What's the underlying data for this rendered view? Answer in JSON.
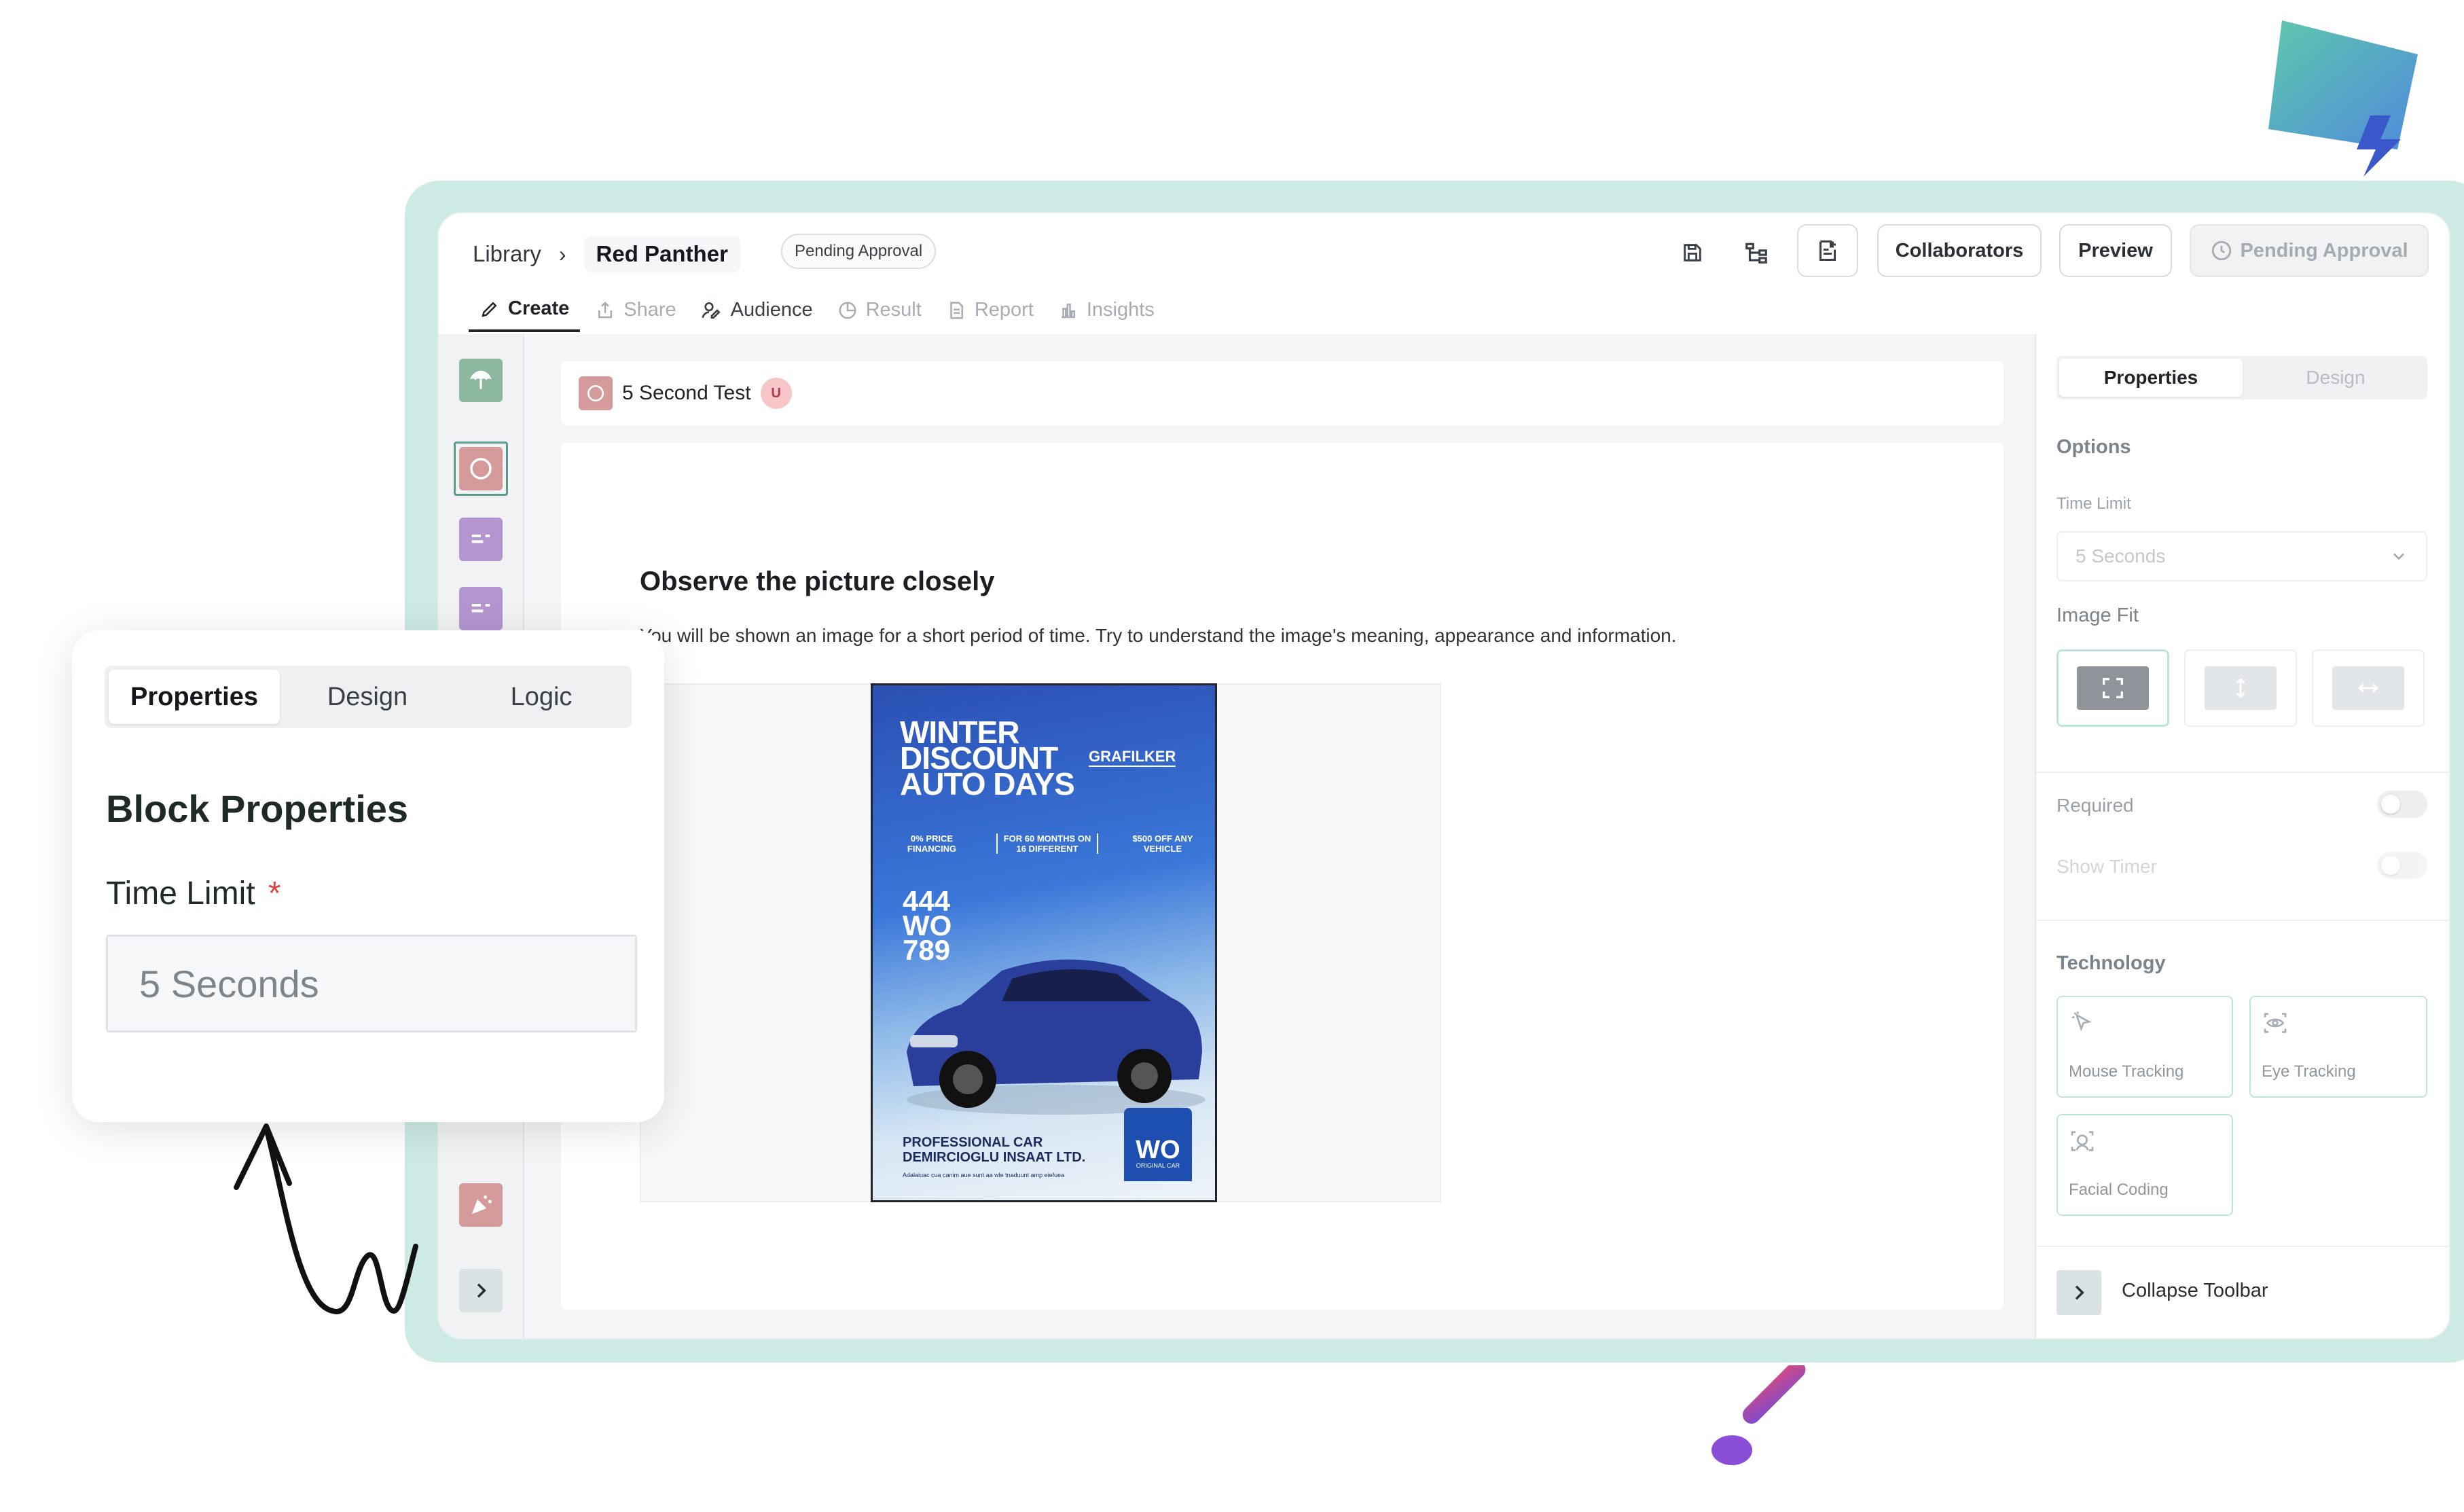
{
  "breadcrumb": {
    "library": "Library",
    "separator": "›",
    "project": "Red Panther"
  },
  "status_pill": "Pending Approval",
  "toolbar": {
    "collaborators": "Collaborators",
    "preview": "Preview",
    "pending": "Pending Approval",
    "icons": [
      "save-icon",
      "flow-icon",
      "add-block-icon",
      "clock-icon"
    ]
  },
  "tabs": [
    {
      "label": "Create",
      "icon": "pencil-icon",
      "active": true
    },
    {
      "label": "Share",
      "icon": "share-icon",
      "active": false
    },
    {
      "label": "Audience",
      "icon": "audience-icon",
      "active": false
    },
    {
      "label": "Result",
      "icon": "pie-icon",
      "active": false
    },
    {
      "label": "Report",
      "icon": "report-icon",
      "active": false
    },
    {
      "label": "Insights",
      "icon": "insights-icon",
      "active": false
    }
  ],
  "block": {
    "title": "5 Second Test",
    "badge": "U"
  },
  "content": {
    "heading": "Observe the picture closely",
    "description": "You will be shown an image for a short period of time. Try to understand the image's meaning, appearance and information."
  },
  "poster": {
    "title_lines": [
      "WINTER",
      "DISCOUNT",
      "AUTO DAYS"
    ],
    "brand": "GRAFILKER",
    "offers": [
      "0% PRICE FINANCING",
      "FOR 60 MONTHS ON 16 DIFFERENT",
      "$500 OFF ANY VEHICLE"
    ],
    "phone_lines": [
      "444",
      "WO",
      "789"
    ],
    "footer_lines": [
      "PROFESSIONAL CAR",
      "DEMIRCIOGLU INSAAT LTD."
    ],
    "fine_print": "Adalaiuac cua canim aue sunt aa wle tnaduunt amp eiefuea",
    "logo": "WO",
    "logo_sub": "ORIGINAL CAR"
  },
  "right_panel": {
    "tabs": [
      "Properties",
      "Design"
    ],
    "options_heading": "Options",
    "time_limit_label": "Time Limit",
    "time_limit_value": "5 Seconds",
    "image_fit_label": "Image Fit",
    "required_label": "Required",
    "show_timer_label": "Show Timer",
    "technology_label": "Technology",
    "technology": [
      "Mouse Tracking",
      "Eye Tracking",
      "Facial Coding"
    ],
    "collapse": "Collapse Toolbar"
  },
  "floating_card": {
    "tabs": [
      "Properties",
      "Design",
      "Logic"
    ],
    "heading": "Block Properties",
    "field_label": "Time Limit",
    "required_marker": "*",
    "field_value": "5 Seconds"
  },
  "colors": {
    "accent_teal": "#cdeae6",
    "rail_green": "#8db8a0",
    "rail_pink": "#d59b9b",
    "rail_purple": "#b595cf",
    "required": "#e0443f"
  }
}
